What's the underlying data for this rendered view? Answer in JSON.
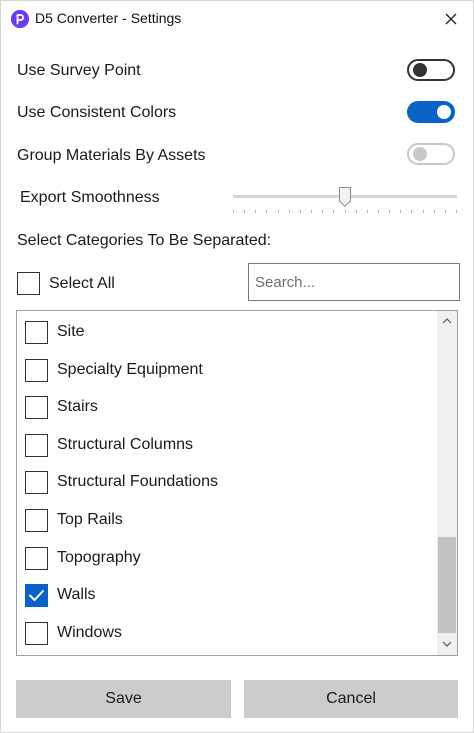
{
  "window": {
    "title": "D5 Converter - Settings",
    "icons": {
      "app": "d5-logo-icon",
      "close": "close-icon"
    },
    "accent_color": "#0a62c8",
    "brand_color": "#6a3df0"
  },
  "options": {
    "survey_point": {
      "label": "Use Survey Point",
      "enabled": false
    },
    "consistent_colors": {
      "label": "Use Consistent Colors",
      "enabled": true
    },
    "group_materials": {
      "label": "Group Materials By Assets",
      "enabled": false,
      "disabled": true
    }
  },
  "smoothness": {
    "label": "Export Smoothness",
    "value_fraction": 0.5
  },
  "categories": {
    "section_label": "Select Categories To Be Separated:",
    "select_all_label": "Select All",
    "select_all_checked": false,
    "search_placeholder": "Search...",
    "items": [
      {
        "label": "Site",
        "checked": false
      },
      {
        "label": "Specialty Equipment",
        "checked": false
      },
      {
        "label": "Stairs",
        "checked": false
      },
      {
        "label": "Structural Columns",
        "checked": false
      },
      {
        "label": "Structural Foundations",
        "checked": false
      },
      {
        "label": "Top Rails",
        "checked": false
      },
      {
        "label": "Topography",
        "checked": false
      },
      {
        "label": "Walls",
        "checked": true
      },
      {
        "label": "Windows",
        "checked": false
      }
    ]
  },
  "buttons": {
    "save": "Save",
    "cancel": "Cancel"
  }
}
